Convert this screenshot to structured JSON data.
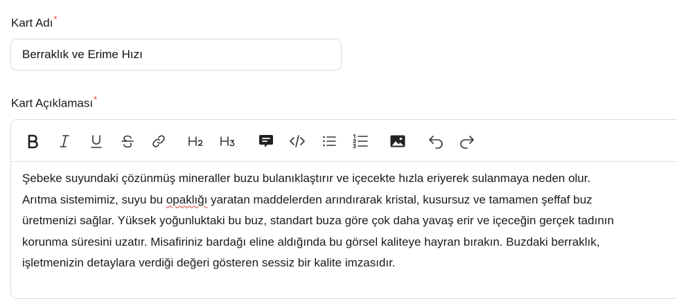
{
  "form": {
    "name_label": "Kart Adı",
    "name_required": "*",
    "name_value": "Berraklık ve Erime Hızı",
    "desc_label": "Kart Açıklaması",
    "desc_required": "*"
  },
  "toolbar": {
    "buttons": [
      {
        "name": "bold-icon"
      },
      {
        "name": "italic-icon"
      },
      {
        "name": "underline-icon"
      },
      {
        "name": "strikethrough-icon"
      },
      {
        "name": "link-icon"
      },
      {
        "name": "heading-2-icon",
        "label": "H2"
      },
      {
        "name": "heading-3-icon",
        "label": "H3"
      },
      {
        "name": "comment-icon"
      },
      {
        "name": "code-icon"
      },
      {
        "name": "bullet-list-icon"
      },
      {
        "name": "ordered-list-icon"
      },
      {
        "name": "image-icon"
      },
      {
        "name": "undo-icon"
      },
      {
        "name": "redo-icon"
      }
    ]
  },
  "editor": {
    "line1": "Şebeke suyundaki çözünmüş mineraller buzu bulanıklaştırır ve içecekte hızla eriyerek sulanmaya neden olur.",
    "line2_before": "Arıtma sistemimiz, suyu bu ",
    "line2_misspelled": "opaklığı",
    "line2_after": " yaratan maddelerden arındırarak kristal, kusursuz ve tamamen şeffaf buz",
    "line3": "üretmenizi sağlar. Yüksek yoğunluktaki bu buz, standart buza göre çok daha yavaş erir ve içeceğin gerçek tadının",
    "line4": "korunma süresini uzatır. Misafiriniz bardağı eline aldığında bu görsel kaliteye hayran bırakın. Buzdaki berraklık,",
    "line5": "işletmenizin detaylara verdiği değeri gösteren sessiz bir kalite imzasıdır."
  }
}
